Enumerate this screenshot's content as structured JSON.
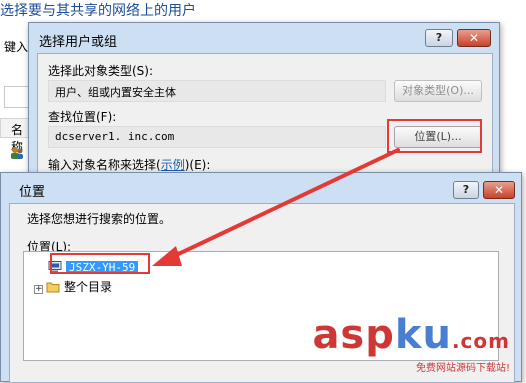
{
  "background": {
    "title": "选择要与其共享的网络上的用户",
    "type_label": "键入",
    "column_header": "名称"
  },
  "select_dialog": {
    "title": "选择用户或组",
    "help": "?",
    "close": "✕",
    "object_type_label": "选择此对象类型(S):",
    "object_type_value": "用户、组或内置安全主体",
    "object_type_button": "对象类型(O)...",
    "location_label": "查找位置(F):",
    "location_value": "dcserver1.   inc.com",
    "location_button": "位置(L)...",
    "enter_names_label": "输入对象名称来选择(",
    "examples_link": "示例",
    "enter_names_suffix": ")(E):"
  },
  "location_dialog": {
    "title": "位置",
    "help": "?",
    "close": "✕",
    "instruction": "选择您想进行搜索的位置。",
    "tree_label": "位置(L):",
    "tree": [
      {
        "label": "JSZX-YH-59",
        "selected": true,
        "icon": "computer-icon"
      },
      {
        "label": "整个目录",
        "selected": false,
        "icon": "folder-icon",
        "expandable": true
      }
    ]
  },
  "annotation": {
    "arrow_color": "#e53935"
  },
  "watermark": {
    "part1": "asp",
    "part2": "ku",
    "part3": ".com",
    "sub": "免费网站源码下载站!"
  }
}
